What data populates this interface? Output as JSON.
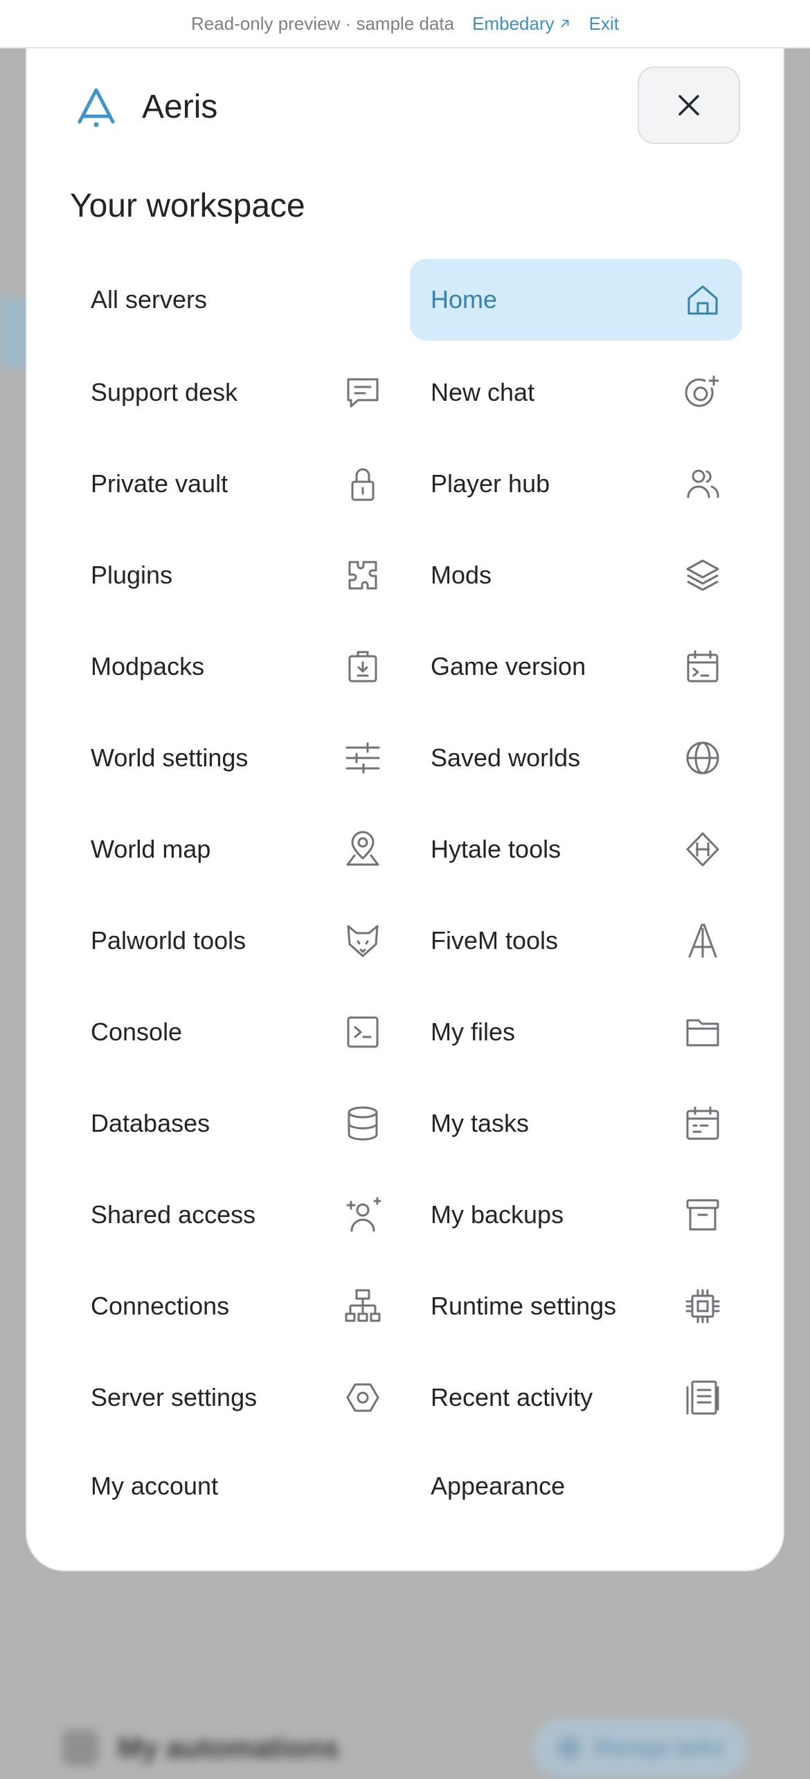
{
  "preview_bar": {
    "note": "Read-only preview · sample data",
    "embedary_link": "Embedary",
    "exit_link": "Exit"
  },
  "background": {
    "title": "My automations",
    "button_label": "Manage tasks"
  },
  "menu": {
    "brand": "Aeris",
    "section_title": "Your workspace",
    "items": [
      {
        "label": "All servers"
      },
      {
        "label": "Home",
        "icon": "home-icon",
        "active": true
      },
      {
        "label": "Support desk",
        "icon": "message-icon"
      },
      {
        "label": "New chat",
        "icon": "chat-plus-icon"
      },
      {
        "label": "Private vault",
        "icon": "lock-icon"
      },
      {
        "label": "Player hub",
        "icon": "users-icon"
      },
      {
        "label": "Plugins",
        "icon": "puzzle-icon"
      },
      {
        "label": "Mods",
        "icon": "layers-icon"
      },
      {
        "label": "Modpacks",
        "icon": "box-download-icon"
      },
      {
        "label": "Game version",
        "icon": "calendar-terminal-icon"
      },
      {
        "label": "World settings",
        "icon": "sliders-icon"
      },
      {
        "label": "Saved worlds",
        "icon": "globe-icon"
      },
      {
        "label": "World map",
        "icon": "map-pin-icon"
      },
      {
        "label": "Hytale tools",
        "icon": "hytale-diamond-icon"
      },
      {
        "label": "Palworld tools",
        "icon": "fox-head-icon"
      },
      {
        "label": "FiveM tools",
        "icon": "fivem-icon"
      },
      {
        "label": "Console",
        "icon": "terminal-icon"
      },
      {
        "label": "My files",
        "icon": "folder-icon"
      },
      {
        "label": "Databases",
        "icon": "database-icon"
      },
      {
        "label": "My tasks",
        "icon": "calendar-tasks-icon"
      },
      {
        "label": "Shared access",
        "icon": "user-plus-icon"
      },
      {
        "label": "My backups",
        "icon": "archive-icon"
      },
      {
        "label": "Connections",
        "icon": "sitemap-icon"
      },
      {
        "label": "Runtime settings",
        "icon": "cpu-icon"
      },
      {
        "label": "Server settings",
        "icon": "hexagon-settings-icon"
      },
      {
        "label": "Recent activity",
        "icon": "activity-log-icon"
      },
      {
        "label": "My account"
      },
      {
        "label": "Appearance"
      }
    ]
  },
  "colors": {
    "accent": "#3482ad",
    "active_bg": "#d4ebfb",
    "icon_gray": "#6f7378",
    "link_blue": "#3f8fc0"
  }
}
